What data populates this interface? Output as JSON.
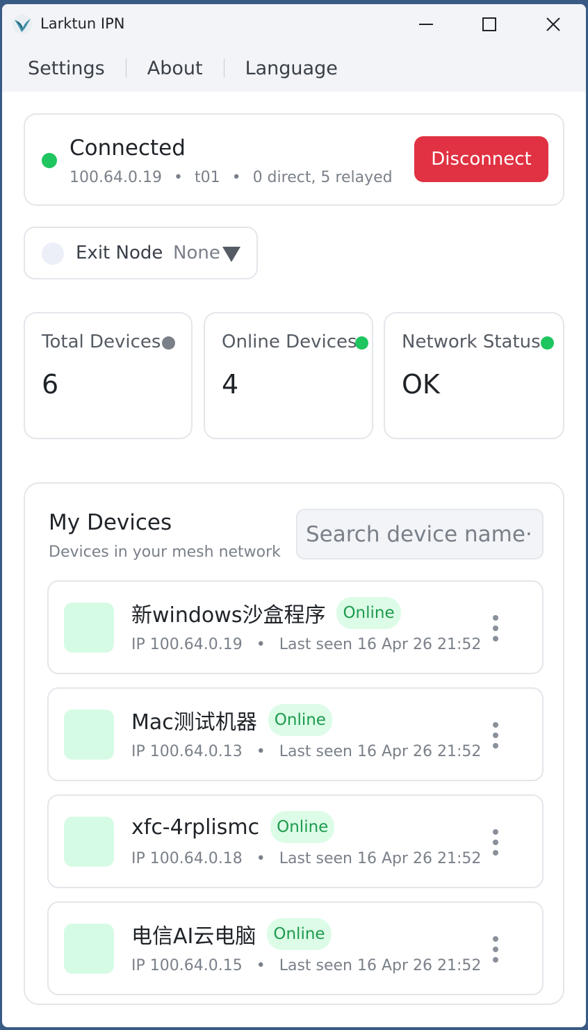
{
  "window": {
    "title": "Larktun IPN"
  },
  "menu": {
    "items": [
      "Settings",
      "About",
      "Language"
    ]
  },
  "status": {
    "title": "Connected",
    "ip": "100.64.0.19",
    "host": "t01",
    "peers": "0 direct, 5 relayed",
    "separator": "•",
    "disconnect_label": "Disconnect",
    "dot_color": "#1fc55e"
  },
  "exit_node": {
    "label": "Exit Node",
    "value": "None"
  },
  "stats": [
    {
      "label": "Total Devices",
      "value": "6",
      "dot_color": "#7b7f88"
    },
    {
      "label": "Online Devices",
      "value": "4",
      "dot_color": "#1fc55e"
    },
    {
      "label": "Network Status",
      "value": "OK",
      "dot_color": "#1fc55e"
    }
  ],
  "devices": {
    "title": "My Devices",
    "subtitle": "Devices in your mesh network",
    "search_placeholder": "Search device name···",
    "items": [
      {
        "name": "新windows沙盒程序",
        "status": "Online",
        "ip": "IP 100.64.0.19",
        "last_seen": "Last seen 16 Apr 26 21:52"
      },
      {
        "name": "Mac测试机器",
        "status": "Online",
        "ip": "IP 100.64.0.13",
        "last_seen": "Last seen 16 Apr 26 21:52"
      },
      {
        "name": "xfc-4rplismc",
        "status": "Online",
        "ip": "IP 100.64.0.18",
        "last_seen": "Last seen 16 Apr 26 21:52"
      },
      {
        "name": "电信AI云电脑",
        "status": "Online",
        "ip": "IP 100.64.0.15",
        "last_seen": "Last seen 16 Apr 26 21:52"
      }
    ]
  },
  "colors": {
    "accent_red": "#e03242",
    "online_green": "#1e9a4e",
    "badge_bg": "#dcfce7"
  }
}
